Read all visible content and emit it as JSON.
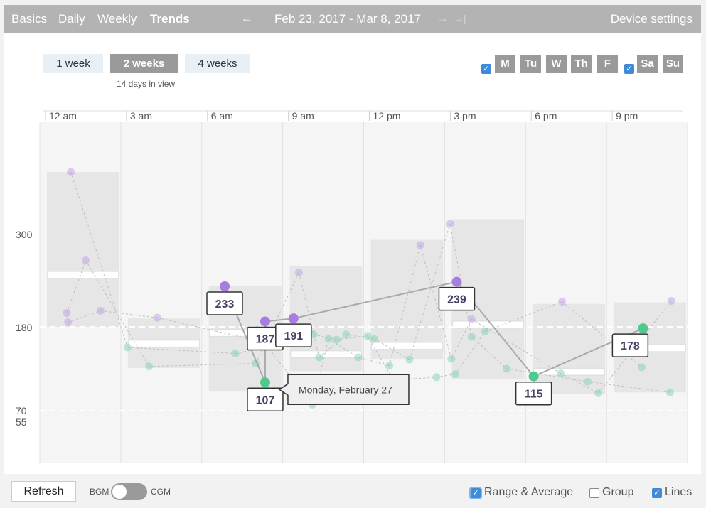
{
  "nav": {
    "tabs": [
      {
        "label": "Basics",
        "active": false
      },
      {
        "label": "Daily",
        "active": false
      },
      {
        "label": "Weekly",
        "active": false
      },
      {
        "label": "Trends",
        "active": true
      }
    ],
    "prev_arrow": "←",
    "date_range": "Feb 23, 2017 - Mar 8, 2017",
    "next_arrow": "→",
    "last_arrow": "→|",
    "device_settings": "Device settings"
  },
  "controls": {
    "range_buttons": [
      {
        "label": "1 week",
        "active": false
      },
      {
        "label": "2 weeks",
        "active": true
      },
      {
        "label": "4 weeks",
        "active": false
      }
    ],
    "days_in_view": "14 days in view",
    "weekdays_checkbox": true,
    "weekday_buttons": [
      "M",
      "Tu",
      "W",
      "Th",
      "F"
    ],
    "weekend_checkbox": true,
    "weekend_buttons": [
      "Sa",
      "Su"
    ],
    "check_glyph": "✓"
  },
  "chart_data": {
    "type": "scatter",
    "x_ticks": [
      "12 am",
      "3 am",
      "6 am",
      "9 am",
      "12 pm",
      "3 pm",
      "6 pm",
      "9 pm"
    ],
    "y_ticks": [
      300,
      180,
      70,
      55
    ],
    "target_lines": [
      180,
      70
    ],
    "ylim": [
      0,
      400
    ],
    "xlim_hours": [
      0,
      24
    ],
    "colors": {
      "high": "#bb9ae7",
      "target": "#76d3a6",
      "range_fill": "#e6e6e6",
      "line": "#aaaaaa",
      "tooltip_border": "#333333"
    },
    "ranges": [
      {
        "start_h": 0,
        "end_h": 3,
        "min": 180,
        "max": 383,
        "mean": 248
      },
      {
        "start_h": 3,
        "end_h": 6,
        "min": 126,
        "max": 191,
        "mean": 158
      },
      {
        "start_h": 6,
        "end_h": 9,
        "min": 95,
        "max": 234,
        "mean": 172
      },
      {
        "start_h": 9,
        "end_h": 12,
        "min": 122,
        "max": 260,
        "mean": 144
      },
      {
        "start_h": 12,
        "end_h": 15,
        "min": 138,
        "max": 294,
        "mean": 155
      },
      {
        "start_h": 15,
        "end_h": 18,
        "min": 112,
        "max": 321,
        "mean": 183
      },
      {
        "start_h": 18,
        "end_h": 21,
        "min": 92,
        "max": 210,
        "mean": 121
      },
      {
        "start_h": 21,
        "end_h": 24,
        "min": 94,
        "max": 212,
        "mean": 152
      }
    ],
    "points": [
      {
        "h": 1.15,
        "v": 383
      },
      {
        "h": 1.7,
        "v": 267
      },
      {
        "h": 1.0,
        "v": 198
      },
      {
        "h": 1.05,
        "v": 186
      },
      {
        "h": 2.25,
        "v": 201
      },
      {
        "h": 4.35,
        "v": 192
      },
      {
        "h": 3.25,
        "v": 153
      },
      {
        "h": 4.05,
        "v": 128
      },
      {
        "h": 7.25,
        "v": 145
      },
      {
        "h": 8.3,
        "v": 160
      },
      {
        "h": 8.0,
        "v": 132
      },
      {
        "h": 9.6,
        "v": 251
      },
      {
        "h": 10.15,
        "v": 170
      },
      {
        "h": 9.45,
        "v": 161
      },
      {
        "h": 10.7,
        "v": 164
      },
      {
        "h": 10.35,
        "v": 140
      },
      {
        "h": 10.1,
        "v": 78
      },
      {
        "h": 11.0,
        "v": 163
      },
      {
        "h": 11.35,
        "v": 170
      },
      {
        "h": 11.8,
        "v": 140
      },
      {
        "h": 12.15,
        "v": 168
      },
      {
        "h": 12.4,
        "v": 164
      },
      {
        "h": 12.95,
        "v": 129
      },
      {
        "h": 13.1,
        "v": 110
      },
      {
        "h": 13.7,
        "v": 137
      },
      {
        "h": 14.1,
        "v": 287
      },
      {
        "h": 14.7,
        "v": 114
      },
      {
        "h": 15.2,
        "v": 315
      },
      {
        "h": 15.25,
        "v": 138
      },
      {
        "h": 15.4,
        "v": 118
      },
      {
        "h": 16.0,
        "v": 167
      },
      {
        "h": 16.5,
        "v": 174
      },
      {
        "h": 17.3,
        "v": 125
      },
      {
        "h": 19.3,
        "v": 119
      },
      {
        "h": 19.35,
        "v": 213
      },
      {
        "h": 20.3,
        "v": 108
      },
      {
        "h": 20.7,
        "v": 93
      },
      {
        "h": 22.3,
        "v": 127
      },
      {
        "h": 23.35,
        "v": 94
      },
      {
        "h": 23.4,
        "v": 214
      },
      {
        "h": 16.0,
        "v": 190
      }
    ],
    "highlighted_day": {
      "name": "Monday, February 27",
      "points": [
        {
          "h": 6.85,
          "v": 233,
          "label": "233"
        },
        {
          "h": 8.35,
          "v": 187,
          "label": "187"
        },
        {
          "h": 8.35,
          "v": 107,
          "label": "107"
        },
        {
          "h": 9.4,
          "v": 191,
          "label": "191"
        },
        {
          "h": 15.45,
          "v": 239,
          "label": "239"
        },
        {
          "h": 18.3,
          "v": 115,
          "label": "115"
        },
        {
          "h": 22.35,
          "v": 178,
          "label": "178"
        }
      ]
    }
  },
  "footer": {
    "refresh": "Refresh",
    "bgm": "BGM",
    "cgm": "CGM",
    "range_average": {
      "label": "Range & Average",
      "checked": true
    },
    "group": {
      "label": "Group",
      "checked": false
    },
    "lines": {
      "label": "Lines",
      "checked": true
    }
  }
}
